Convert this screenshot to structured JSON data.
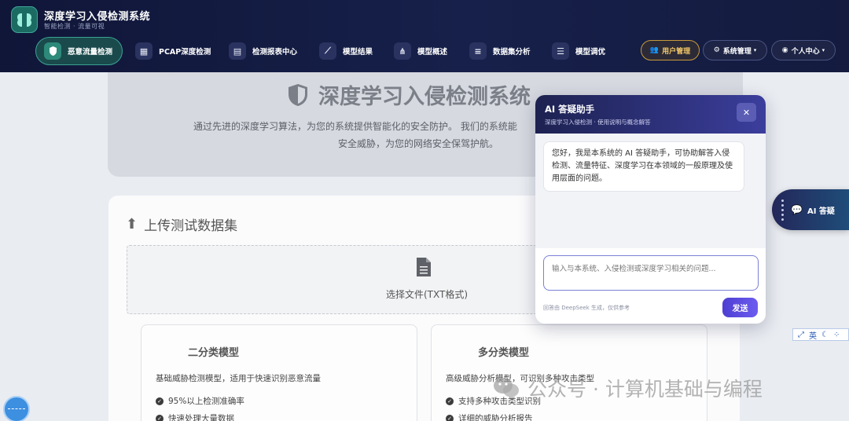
{
  "app": {
    "title": "深度学习入侵检测系统",
    "subtitle": "智能检测 · 流量可视"
  },
  "nav": {
    "items": [
      {
        "label": "恶意流量检测",
        "icon": "shield-icon",
        "active": true
      },
      {
        "label": "PCAP深度检测",
        "icon": "sitemap-icon"
      },
      {
        "label": "检测报表中心",
        "icon": "file-report-icon"
      },
      {
        "label": "模型结果",
        "icon": "line-chart-icon"
      },
      {
        "label": "模型概述",
        "icon": "network-icon"
      },
      {
        "label": "数据集分析",
        "icon": "database-icon"
      },
      {
        "label": "模型调优",
        "icon": "sliders-icon"
      }
    ],
    "user_mgmt": "用户管理",
    "sys_mgmt": "系统管理",
    "personal": "个人中心"
  },
  "hero": {
    "title": "深度学习入侵检测系统",
    "desc_line1": "通过先进的深度学习算法，为您的系统提供智能化的安全防护。 我们的系统能",
    "desc_line2": "安全威胁，为您的网络安全保驾护航。"
  },
  "upload": {
    "title": "上传测试数据集",
    "file_label": "选择文件(TXT格式)"
  },
  "models": [
    {
      "title": "二分类模型",
      "desc": "基础威胁检测模型，适用于快速识别恶意流量",
      "features": [
        "95%以上检测准确率",
        "快速处理大量数据"
      ]
    },
    {
      "title": "多分类模型",
      "desc": "高级威胁分析模型，可识别多种攻击类型",
      "features": [
        "支持多种攻击类型识别",
        "详细的威胁分析报告"
      ]
    }
  ],
  "chat": {
    "title": "AI 答疑助手",
    "subtitle": "深度学习入侵检测 · 使用说明与概念解答",
    "welcome": "您好，我是本系统的 AI 答疑助手，可协助解答入侵检测、流量特征、深度学习在本领域的一般原理及使用层面的问题。",
    "input_placeholder": "输入与本系统、入侵检测或深度学习相关的问题...",
    "note": "回答由 DeepSeek 生成，仅供参考",
    "send_label": "发送"
  },
  "ai_fab": {
    "label": "AI 答疑"
  },
  "ime": {
    "lang": "英"
  },
  "watermark": {
    "text": "公众号 · 计算机基础与编程"
  },
  "colors": {
    "nav_bg": "#141b3f",
    "active_teal": "#3ba394",
    "gold": "#c89b3b",
    "send_purple": "#5a4ae0"
  }
}
